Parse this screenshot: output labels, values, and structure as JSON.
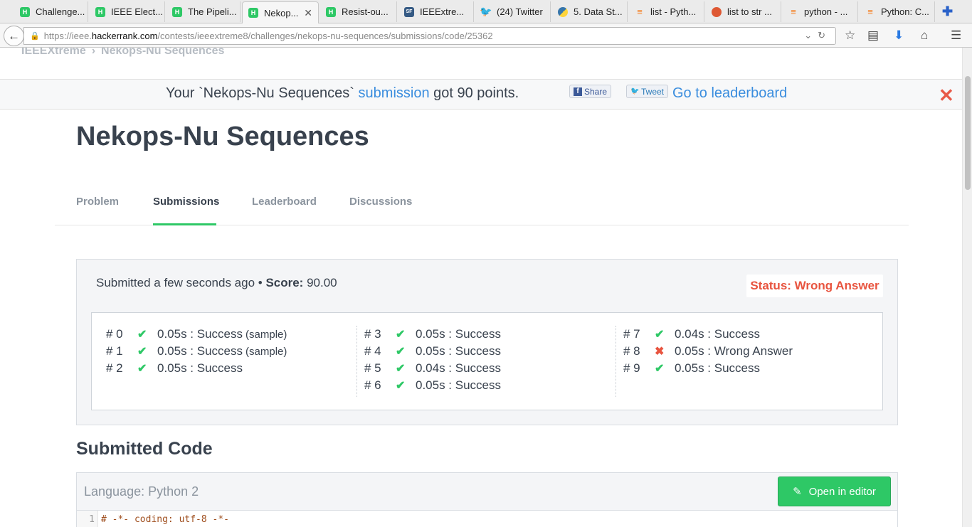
{
  "browser": {
    "tabs": [
      {
        "label": "Challenge..."
      },
      {
        "label": "IEEE Elect..."
      },
      {
        "label": "The Pipeli..."
      },
      {
        "label": "Nekop..."
      },
      {
        "label": "Resist-ou..."
      },
      {
        "label": "IEEExtre..."
      },
      {
        "label": "(24) Twitter"
      },
      {
        "label": "5. Data St..."
      },
      {
        "label": "list - Pyth..."
      },
      {
        "label": "list to str ..."
      },
      {
        "label": "python - ..."
      },
      {
        "label": "Python: C..."
      }
    ],
    "url_prefix": "https://ieee.",
    "url_host": "hackerrank.com",
    "url_path": "/contests/ieeextreme8/challenges/nekops-nu-sequences/submissions/code/25362"
  },
  "breadcrumb": {
    "root": "IEEEXtreme",
    "current": "Nekops-Nu Sequences"
  },
  "notice": {
    "prefix": "Your `Nekops-Nu Sequences`",
    "link": "submission",
    "suffix": "got 90 points.",
    "share_label": "Share",
    "tweet_label": "Tweet",
    "leaderboard_link": "Go to leaderboard",
    "close_glyph": "✕"
  },
  "page_title": "Nekops-Nu Sequences",
  "page_tabs": [
    {
      "label": "Problem"
    },
    {
      "label": "Submissions"
    },
    {
      "label": "Leaderboard"
    },
    {
      "label": "Discussions"
    }
  ],
  "submission": {
    "submitted_text": "Submitted a few seconds ago •",
    "score_label": "Score:",
    "score_value": "90.00",
    "status": "Status: Wrong Answer"
  },
  "testcases": [
    [
      {
        "id": "# 0",
        "mark": "✔",
        "ok": true,
        "text": "0.05s : Success",
        "note": "(sample)"
      },
      {
        "id": "# 1",
        "mark": "✔",
        "ok": true,
        "text": "0.05s : Success",
        "note": "(sample)"
      },
      {
        "id": "# 2",
        "mark": "✔",
        "ok": true,
        "text": "0.05s : Success",
        "note": ""
      }
    ],
    [
      {
        "id": "# 3",
        "mark": "✔",
        "ok": true,
        "text": "0.05s : Success",
        "note": ""
      },
      {
        "id": "# 4",
        "mark": "✔",
        "ok": true,
        "text": "0.05s : Success",
        "note": ""
      },
      {
        "id": "# 5",
        "mark": "✔",
        "ok": true,
        "text": "0.04s : Success",
        "note": ""
      },
      {
        "id": "# 6",
        "mark": "✔",
        "ok": true,
        "text": "0.05s : Success",
        "note": ""
      }
    ],
    [
      {
        "id": "# 7",
        "mark": "✔",
        "ok": true,
        "text": "0.04s : Success",
        "note": ""
      },
      {
        "id": "# 8",
        "mark": "✖",
        "ok": false,
        "text": "0.05s : Wrong Answer",
        "note": ""
      },
      {
        "id": "# 9",
        "mark": "✔",
        "ok": true,
        "text": "0.05s : Success",
        "note": ""
      }
    ]
  ],
  "code": {
    "title": "Submitted Code",
    "language": "Language: Python 2",
    "open_editor": "Open in editor",
    "lines": [
      {
        "no": "1",
        "text": "# -*- coding: utf-8 -*-"
      }
    ]
  },
  "colors": {
    "accent": "#2ec866",
    "error": "#e8543f",
    "link": "#3a8dde",
    "text": "#39424e"
  }
}
